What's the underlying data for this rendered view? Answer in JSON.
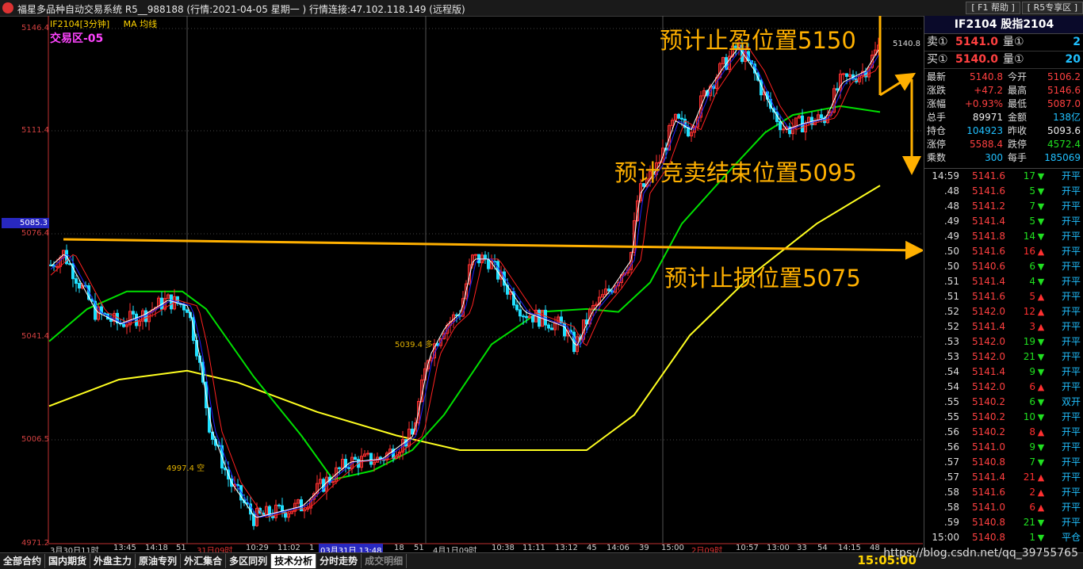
{
  "app": {
    "title": "福星多品种自动交易系统 R5__988188  (行情:2021-04-05 星期一 )  行情连接:47.102.118.149 (远程版)",
    "menu": [
      "[ F1 帮助 ]",
      "[ R5专享区 ]"
    ]
  },
  "chart": {
    "indicator": "IF2104[3分钟]",
    "ma_label": "MA 均线",
    "zone": "交易区-05",
    "y_labels": [
      "5146.4",
      "5111.4",
      "5076.4",
      "5041.4",
      "5006.5",
      "4971.2"
    ],
    "y_highlight": "5085.3",
    "last_price_tag": "5140.8",
    "x_labels": [
      {
        "text": "3月30日11时",
        "style": ""
      },
      {
        "text": "13:45",
        "style": ""
      },
      {
        "text": "14:18",
        "style": ""
      },
      {
        "text": "51",
        "style": ""
      },
      {
        "text": "31日09时",
        "style": "red"
      },
      {
        "text": "10:29",
        "style": ""
      },
      {
        "text": "11:02",
        "style": ""
      },
      {
        "text": "1",
        "style": ""
      },
      {
        "text": "03月31日 13:48",
        "style": "hl"
      },
      {
        "text": "18",
        "style": ""
      },
      {
        "text": "51",
        "style": ""
      },
      {
        "text": "4月1日09时",
        "style": ""
      },
      {
        "text": "10:38",
        "style": ""
      },
      {
        "text": "11:11",
        "style": ""
      },
      {
        "text": "13:12",
        "style": ""
      },
      {
        "text": "45",
        "style": ""
      },
      {
        "text": "14:06",
        "style": ""
      },
      {
        "text": "39",
        "style": ""
      },
      {
        "text": "15:00",
        "style": ""
      },
      {
        "text": "2日09时",
        "style": "red"
      },
      {
        "text": "10:57",
        "style": ""
      },
      {
        "text": "13:00",
        "style": ""
      },
      {
        "text": "33",
        "style": ""
      },
      {
        "text": "54",
        "style": ""
      },
      {
        "text": "14:15",
        "style": ""
      },
      {
        "text": "48",
        "style": ""
      }
    ],
    "price_notes": [
      "5039.4 多",
      "4997.4 空"
    ],
    "annotations": {
      "take_profit": "预计止盈位置5150",
      "auction_end": "预计竞卖结束位置5095",
      "stop_loss": "预计止损位置5075"
    },
    "colors": {
      "up": "#ff3030",
      "down": "#20e0ff",
      "ma1": "#ffffff",
      "ma2": "#2020ff",
      "ma3": "#ff2020",
      "ma4": "#00e000",
      "ma5": "#ffff20",
      "arrow": "#ffb000"
    }
  },
  "quote": {
    "header": "IF2104  股指2104",
    "ask": {
      "label": "卖①",
      "price": "5141.0",
      "qty_label": "量①",
      "qty": "2"
    },
    "bid": {
      "label": "买①",
      "price": "5140.0",
      "qty_label": "量①",
      "qty": "20"
    },
    "stats": [
      {
        "k": "最新",
        "a": "5140.8",
        "ac": "red",
        "k2": "今开",
        "b": "5106.2",
        "bc": "red"
      },
      {
        "k": "涨跌",
        "a": "+47.2",
        "ac": "red",
        "k2": "最高",
        "b": "5146.6",
        "bc": "red"
      },
      {
        "k": "涨幅",
        "a": "+0.93%",
        "ac": "red",
        "k2": "最低",
        "b": "5087.0",
        "bc": "red"
      },
      {
        "k": "总手",
        "a": "89971",
        "ac": "white",
        "k2": "金额",
        "b": "138亿",
        "bc": "cyan"
      },
      {
        "k": "持仓",
        "a": "104923",
        "ac": "cyan",
        "k2": "昨收",
        "b": "5093.6",
        "bc": "white"
      },
      {
        "k": "涨停",
        "a": "5588.4",
        "ac": "red",
        "k2": "跌停",
        "b": "4572.4",
        "bc": "green"
      },
      {
        "k": "乘数",
        "a": "300",
        "ac": "cyan",
        "k2": "每手",
        "b": "185069",
        "bc": "cyan"
      }
    ],
    "trades": [
      {
        "t": "14:59",
        "p": "5141.6",
        "v": "17",
        "d": "down",
        "f": "开平"
      },
      {
        "t": ".48",
        "p": "5141.6",
        "v": "5",
        "d": "down",
        "f": "开平"
      },
      {
        "t": ".48",
        "p": "5141.2",
        "v": "7",
        "d": "down",
        "f": "开平"
      },
      {
        "t": ".49",
        "p": "5141.4",
        "v": "5",
        "d": "down",
        "f": "开平"
      },
      {
        "t": ".49",
        "p": "5141.8",
        "v": "14",
        "d": "down",
        "f": "开平"
      },
      {
        "t": ".50",
        "p": "5141.6",
        "v": "16",
        "d": "up",
        "f": "开平"
      },
      {
        "t": ".50",
        "p": "5140.6",
        "v": "6",
        "d": "down",
        "f": "开平"
      },
      {
        "t": ".51",
        "p": "5141.4",
        "v": "4",
        "d": "down",
        "f": "开平"
      },
      {
        "t": ".51",
        "p": "5141.6",
        "v": "5",
        "d": "up",
        "f": "开平"
      },
      {
        "t": ".52",
        "p": "5142.0",
        "v": "12",
        "d": "up",
        "f": "开平"
      },
      {
        "t": ".52",
        "p": "5141.4",
        "v": "3",
        "d": "up",
        "f": "开平"
      },
      {
        "t": ".53",
        "p": "5142.0",
        "v": "19",
        "d": "down",
        "f": "开平"
      },
      {
        "t": ".53",
        "p": "5142.0",
        "v": "21",
        "d": "down",
        "f": "开平"
      },
      {
        "t": ".54",
        "p": "5141.4",
        "v": "9",
        "d": "down",
        "f": "开平"
      },
      {
        "t": ".54",
        "p": "5142.0",
        "v": "6",
        "d": "up",
        "f": "开平"
      },
      {
        "t": ".55",
        "p": "5140.2",
        "v": "6",
        "d": "down",
        "f": "双开"
      },
      {
        "t": ".55",
        "p": "5140.2",
        "v": "10",
        "d": "down",
        "f": "开平"
      },
      {
        "t": ".56",
        "p": "5140.2",
        "v": "8",
        "d": "up",
        "f": "开平"
      },
      {
        "t": ".56",
        "p": "5141.0",
        "v": "9",
        "d": "down",
        "f": "开平"
      },
      {
        "t": ".57",
        "p": "5140.8",
        "v": "7",
        "d": "down",
        "f": "开平"
      },
      {
        "t": ".57",
        "p": "5141.4",
        "v": "21",
        "d": "up",
        "f": "开平"
      },
      {
        "t": ".58",
        "p": "5141.6",
        "v": "2",
        "d": "up",
        "f": "开平"
      },
      {
        "t": ".58",
        "p": "5141.0",
        "v": "6",
        "d": "up",
        "f": "开平"
      },
      {
        "t": ".59",
        "p": "5140.8",
        "v": "21",
        "d": "down",
        "f": "开平"
      },
      {
        "t": "15:00",
        "p": "5140.8",
        "v": "1",
        "d": "down",
        "f": "平仓"
      }
    ]
  },
  "tabs": [
    "全部合约",
    "国内期货",
    "外盘主力",
    "原油专列",
    "外汇集合",
    "多区同列",
    "技术分析",
    "分时走势",
    "成交明细"
  ],
  "active_tab": "技术分析",
  "clock": "15:05:00",
  "watermark": "https://blog.csdn.net/qq_39755765"
}
